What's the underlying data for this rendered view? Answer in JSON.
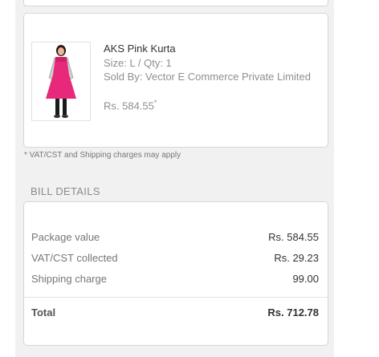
{
  "item": {
    "name": "AKS Pink Kurta",
    "size_qty": "Size: L / Qty: 1",
    "seller": "Sold By: Vector E Commerce Private Limited",
    "price": "Rs. 584.55",
    "price_mark": "*"
  },
  "note": "* VAT/CST and Shipping charges may apply",
  "bill": {
    "heading": "BILL DETAILS",
    "rows": [
      {
        "label": "Package value",
        "value": "Rs. 584.55"
      },
      {
        "label": "VAT/CST collected",
        "value": "Rs. 29.23"
      },
      {
        "label": "Shipping charge",
        "value": "99.00"
      }
    ],
    "total": {
      "label": "Total",
      "value": "Rs. 712.78"
    }
  },
  "colors": {
    "panel_bg": "#f1f1f1",
    "card_border": "#d6d6d6",
    "kurta_pink": "#e8287a"
  }
}
